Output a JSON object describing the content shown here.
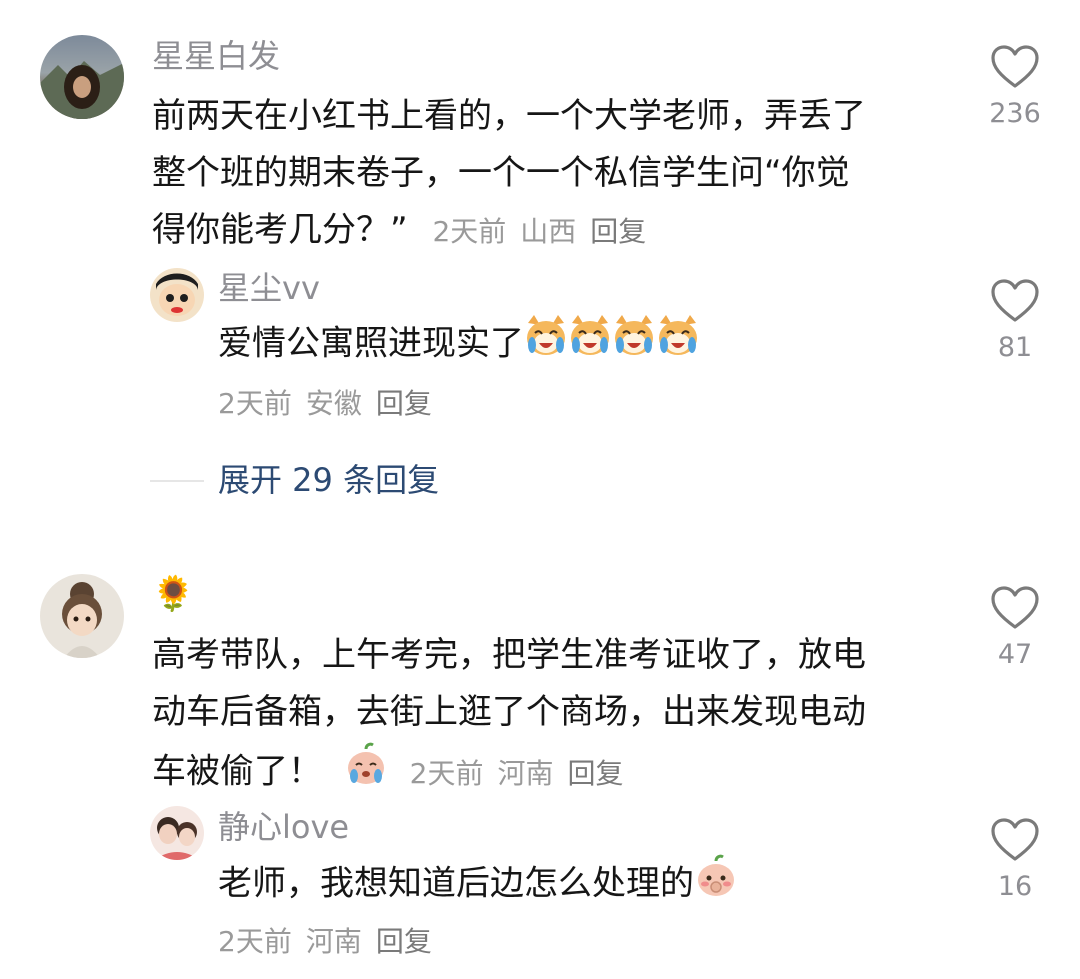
{
  "comments": [
    {
      "author": "星星白发",
      "text_line1": "前两天在小红书上看的，一个大学老师，弄丢了",
      "text_line2": "整个班的期末卷子，一个一个私信学生问“你觉",
      "text_line3": "得你能考几分？”",
      "time": "2天前",
      "location": "山西",
      "reply_label": "回复",
      "likes": "236",
      "replies": [
        {
          "author": "星尘vv",
          "text": "爱情公寓照进现实了",
          "emoji": [
            "laugh-cry-cat-emoji",
            "laugh-cry-cat-emoji",
            "laugh-cry-cat-emoji",
            "laugh-cry-cat-emoji"
          ],
          "time": "2天前",
          "location": "安徽",
          "reply_label": "回复",
          "likes": "81"
        }
      ],
      "expand_label": "展开 29 条回复"
    },
    {
      "author": "🌻",
      "text_line1": "高考带队，上午考完，把学生准考证收了，放电",
      "text_line2": "动车后备箱，去街上逛了个商场，出来发现电动",
      "text_line3": "车被偷了！",
      "emoji": "crying-peach-emoji",
      "time": "2天前",
      "location": "河南",
      "reply_label": "回复",
      "likes": "47",
      "replies": [
        {
          "author": "静心love",
          "text": "老师，我想知道后边怎么处理的",
          "emoji": "shy-peach-emoji",
          "time": "2天前",
          "location": "河南",
          "reply_label": "回复",
          "likes": "16"
        }
      ]
    }
  ],
  "colors": {
    "name": "#8e8e93",
    "text": "#161616",
    "meta": "#9a9a9a",
    "expand": "#2c4a73"
  }
}
